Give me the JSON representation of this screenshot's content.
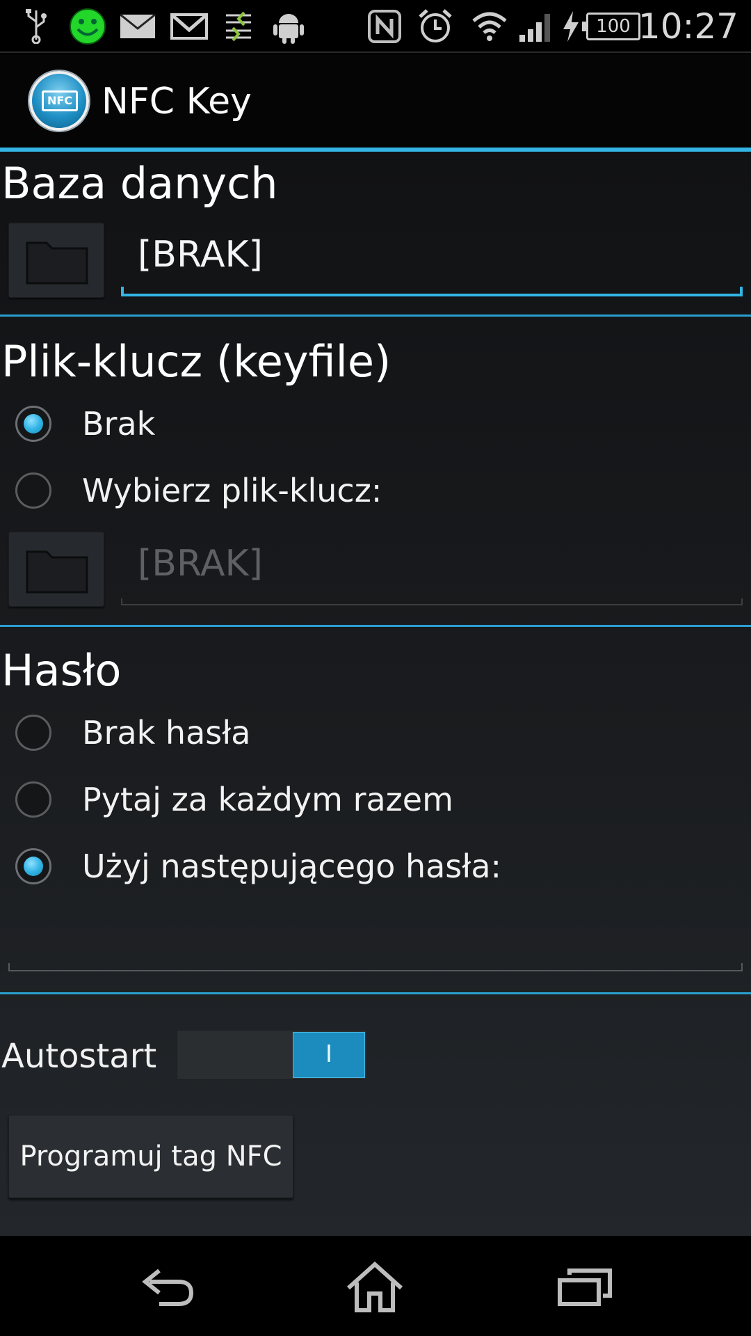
{
  "status_bar": {
    "time": "10:27",
    "battery_level": "100",
    "icons": [
      "usb-icon",
      "smiley-icon",
      "email-icon",
      "gmail-icon",
      "data-transfer-icon",
      "android-icon",
      "nfc-icon",
      "alarm-icon",
      "wifi-icon",
      "signal-icon",
      "charging-icon"
    ]
  },
  "action_bar": {
    "app_title": "NFC Key",
    "logo_text": "NFC",
    "accent_color": "#33b5e5"
  },
  "database": {
    "title": "Baza danych",
    "value": "[BRAK]"
  },
  "keyfile": {
    "title": "Plik-klucz (keyfile)",
    "options": [
      {
        "label": "Brak",
        "checked": true
      },
      {
        "label": "Wybierz plik-klucz:",
        "checked": false
      }
    ],
    "value": "[BRAK]"
  },
  "password": {
    "title": "Hasło",
    "options": [
      {
        "label": "Brak hasła",
        "checked": false
      },
      {
        "label": "Pytaj za każdym razem",
        "checked": false
      },
      {
        "label": "Użyj następującego hasła:",
        "checked": true
      }
    ],
    "value": ""
  },
  "autostart": {
    "label": "Autostart",
    "toggle_on_text": "I",
    "on": true
  },
  "program_button": {
    "label": "Programuj tag NFC"
  },
  "navigation": {
    "buttons": [
      "back-icon",
      "home-icon",
      "recent-apps-icon"
    ]
  }
}
